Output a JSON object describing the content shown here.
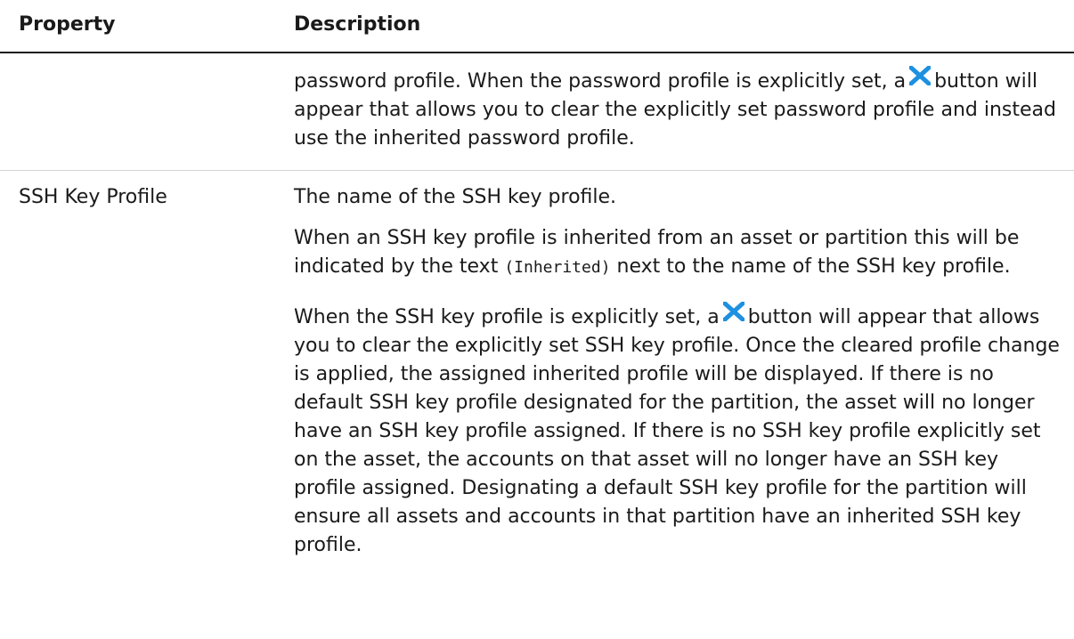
{
  "header": {
    "col1": "Property",
    "col2": "Description"
  },
  "rows": [
    {
      "property": "",
      "desc_before_icon": "password profile. When the password profile is explicitly set, a",
      "desc_after_icon": "button will appear that allows you to clear the explicitly set password profile and instead use the inherited password profile.",
      "icon": "clear-x-icon"
    },
    {
      "property": "SSH Key Profile",
      "p1": "The name of the SSH key profile.",
      "p2_before": "When an SSH key profile is inherited from an asset or partition this will be indicated by the text",
      "p2_code": "(Inherited)",
      "p2_after": "next to the name of the SSH key profile.",
      "p3_before_icon": "When the SSH key profile is explicitly set, a",
      "p3_after_icon": "button will appear that allows you to clear the explicitly set SSH key profile. Once the cleared profile change is applied, the assigned inherited profile will be displayed. If there is no default SSH key profile designated for the partition, the asset will no longer have an SSH key profile assigned. If there is no SSH key profile explicitly set on the asset, the accounts on that asset will no longer have an SSH key profile assigned. Designating a default SSH key profile for the partition will ensure all assets and accounts in that partition have an inherited SSH key profile.",
      "icon": "clear-x-icon"
    }
  ],
  "colors": {
    "icon_blue": "#1e90e0",
    "text": "#1a1a1a",
    "row_divider": "#d4d4d4"
  }
}
